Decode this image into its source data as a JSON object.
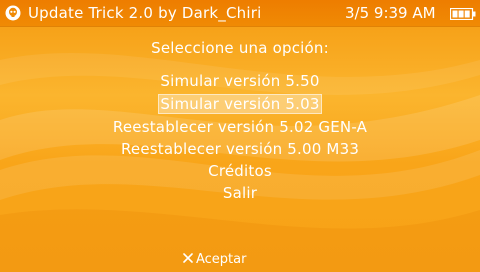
{
  "statusbar": {
    "title": "Update Trick 2.0 by Dark_Chiri",
    "clock": "3/5 9:39 AM",
    "battery_icon": "battery-icon",
    "app_icon": "skull-icon"
  },
  "menu": {
    "heading": "Seleccione una opción:",
    "items": [
      {
        "label": "Simular versión 5.50"
      },
      {
        "label": "Simular versión 5.03"
      },
      {
        "label": "Reestablecer versión 5.02 GEN-A"
      },
      {
        "label": "Reestablecer versión 5.00 M33"
      },
      {
        "label": "Créditos"
      },
      {
        "label": "Salir"
      }
    ],
    "selected_index": 1
  },
  "footer": {
    "accept_label": "Aceptar",
    "accept_icon": "cross-button-icon"
  }
}
